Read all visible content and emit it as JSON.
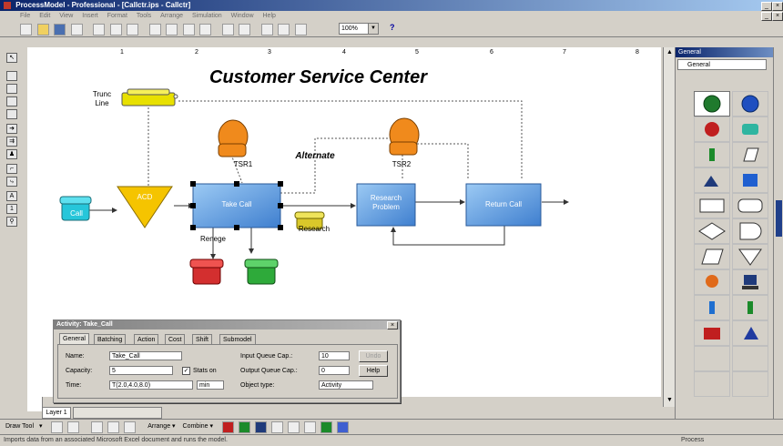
{
  "window": {
    "title": "ProcessModel - Professional - [Callctr.ips - Callctr]",
    "minimize": "_",
    "restore": "❐",
    "close": "×"
  },
  "menu": [
    "File",
    "Edit",
    "View",
    "Insert",
    "Format",
    "Tools",
    "Arrange",
    "Simulation",
    "Window",
    "Help"
  ],
  "toolbar": {
    "zoom": "100%",
    "help": "?"
  },
  "ruler": {
    "ticks": [
      "1",
      "2",
      "3",
      "4",
      "5",
      "6",
      "7",
      "8"
    ]
  },
  "diagram": {
    "title": "Customer Service Center",
    "trunk_line_label": "Trunc\nLine",
    "call_label": "Call",
    "acd_label": "ACD",
    "take_call_label": "Take Call",
    "research_problem_label": "Research\nProblem",
    "return_call_label": "Return Call",
    "tsr1_label": "TSR1",
    "tsr2_label": "TSR2",
    "alternate_label": "Alternate",
    "renege_label": "Renege",
    "research_label": "Research"
  },
  "dialog": {
    "title": "Activity: Take_Call",
    "close": "×",
    "tabs": [
      "General",
      "Batching",
      "Action",
      "Cost",
      "Shift",
      "Submodel"
    ],
    "name_label": "Name:",
    "name_value": "Take_Call",
    "capacity_label": "Capacity:",
    "capacity_value": "5",
    "stats_on_label": "Stats on",
    "time_label": "Time:",
    "time_value": "T(2.0,4.0,8.0)",
    "time_unit": "min",
    "input_queue_label": "Input Queue Cap.:",
    "input_queue_value": "10",
    "output_queue_label": "Output Queue Cap.:",
    "output_queue_value": "0",
    "object_type_label": "Object type:",
    "object_type_value": "Activity",
    "help_button": "Help",
    "undo_button": "Undo"
  },
  "layer_tab": "Layer 1",
  "drawbar": {
    "draw_tool": "Draw Tool",
    "arrange": "Arrange",
    "combine": "Combine"
  },
  "status": {
    "message": "Imports data from an associated Microsoft Excel document and runs the model.",
    "mode": "Process"
  },
  "palette": {
    "header": "General",
    "selector": "General",
    "header_close": "×"
  },
  "colors": {
    "title_blue": "#0a246a",
    "activity_blue": "#5b9bd5",
    "acd_yellow": "#f5c400",
    "phone_yellow": "#e8e000",
    "phone_cyan": "#26c6da",
    "phone_red": "#d32f2f",
    "phone_green": "#2eaa3a",
    "person_orange": "#f08a1c"
  }
}
